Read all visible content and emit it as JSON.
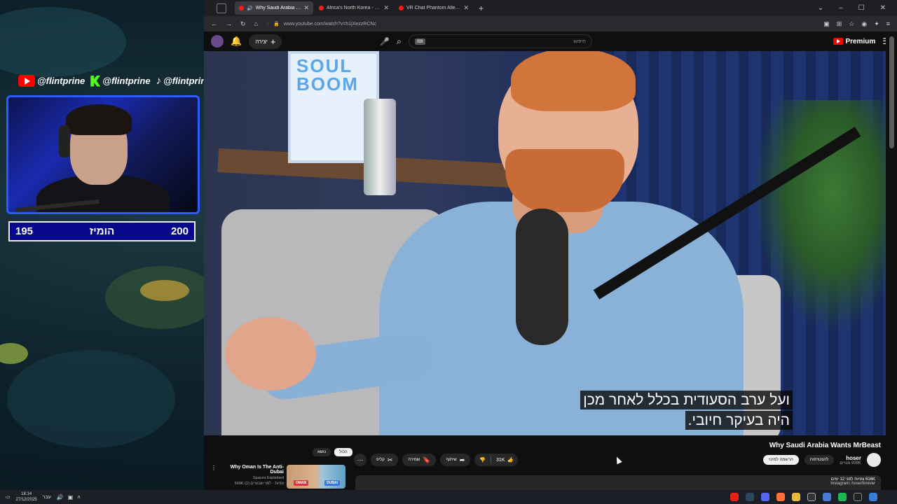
{
  "overlay": {
    "socials": [
      {
        "platform_icon": "youtube-icon",
        "handle": "@flintprine"
      },
      {
        "platform_icon": "kick-icon",
        "handle": "@flintprine"
      },
      {
        "platform_icon": "tiktok-icon",
        "handle": "@flintprine"
      }
    ],
    "score": {
      "left": "195",
      "label": "הומיז",
      "right": "200"
    }
  },
  "browser": {
    "tabs": [
      {
        "title": "Why Saudi Arabia Wants M",
        "active": true
      },
      {
        "title": "Africa's North Korea - YouTube",
        "active": false
      },
      {
        "title": "VR Chat Phantom Allergies Fea",
        "active": false
      }
    ],
    "url": "www.youtube.com/watch?v=h1jXezzRCNc"
  },
  "youtube": {
    "create_label": "יצירה",
    "search_placeholder": "חיפוש",
    "premium_label": "Premium",
    "subtitles": [
      "ועל ערב הסעודית בכלל לאחר מכן",
      "היה בעיקר חיובי."
    ],
    "video_title": "Why Saudi Arabia Wants MrBeast",
    "channel_name": "hoser",
    "channel_subs": "939K מנויים",
    "subscribe_label": "להצטרפות",
    "subscribed_label": "הרשמה למינוי",
    "likes": "31K",
    "share_label": "שיתוף",
    "save_label": "שמירה",
    "clip_label": "קליפ",
    "desc_views": "616K צפיות  לפני 12 ימים",
    "desc_instagram": "Instagram: hoserforever",
    "chips": {
      "all": "הכול",
      "related": "נושא"
    },
    "recommendation": {
      "title": "Why Oman Is The Anti-Dubai",
      "channel": "Spaces Explained",
      "meta": "569K צפיות · לפני שבועיים (2)",
      "thumb_labels": [
        "OMAN",
        "DUBAI"
      ]
    }
  },
  "taskbar": {
    "time": "18:14",
    "date": "27/12/2025",
    "lang": "עבר"
  }
}
